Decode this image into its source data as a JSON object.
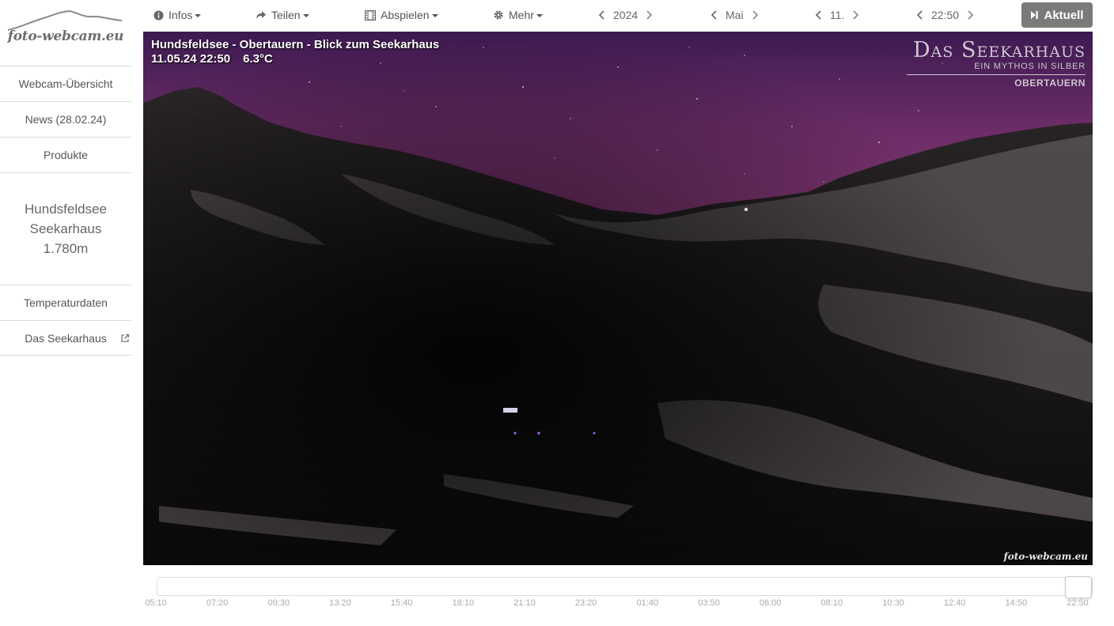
{
  "logo": {
    "text": "foto-webcam.eu"
  },
  "nav": {
    "items": [
      {
        "label": "Webcam-Übersicht"
      },
      {
        "label": "News (28.02.24)"
      },
      {
        "label": "Produkte"
      }
    ],
    "location": {
      "line1": "Hundsfeldsee",
      "line2": "Seekarhaus",
      "line3": "1.780m"
    },
    "items2": [
      {
        "label": "Temperaturdaten"
      },
      {
        "label": "Das Seekarhaus"
      }
    ]
  },
  "toolbar": {
    "infos": "Infos",
    "teilen": "Teilen",
    "abspielen": "Abspielen",
    "mehr": "Mehr",
    "year": "2024",
    "month": "Mai",
    "day": "11.",
    "time": "22:50",
    "aktuell": "Aktuell"
  },
  "cam": {
    "title": "Hundsfeldsee - Obertauern - Blick zum Seekarhaus",
    "date": "11.05.24 22:50",
    "temp": "6.3°C",
    "brand_main": "Das Seekarhaus",
    "brand_tag": "EIN MYTHOS IN SILBER",
    "brand_loc": "OBERTAUERN",
    "watermark": "foto-webcam.eu"
  },
  "timeline": {
    "position_fraction": 1.0,
    "ticks": [
      "05:10",
      "07:20",
      "09:30",
      "13:20",
      "15:40",
      "18:10",
      "21:10",
      "23:20",
      "01:40",
      "03:50",
      "06:00",
      "08:10",
      "10:30",
      "12:40",
      "14:50",
      "22:50"
    ]
  },
  "colors": {
    "accent_button": "#7a7a7a",
    "sky": "#7a2f6e"
  },
  "icons": {
    "infos": "info-circle-icon",
    "teilen": "share-icon",
    "abspielen": "film-icon",
    "mehr": "gear-icon",
    "aktuell": "skip-forward-icon"
  }
}
